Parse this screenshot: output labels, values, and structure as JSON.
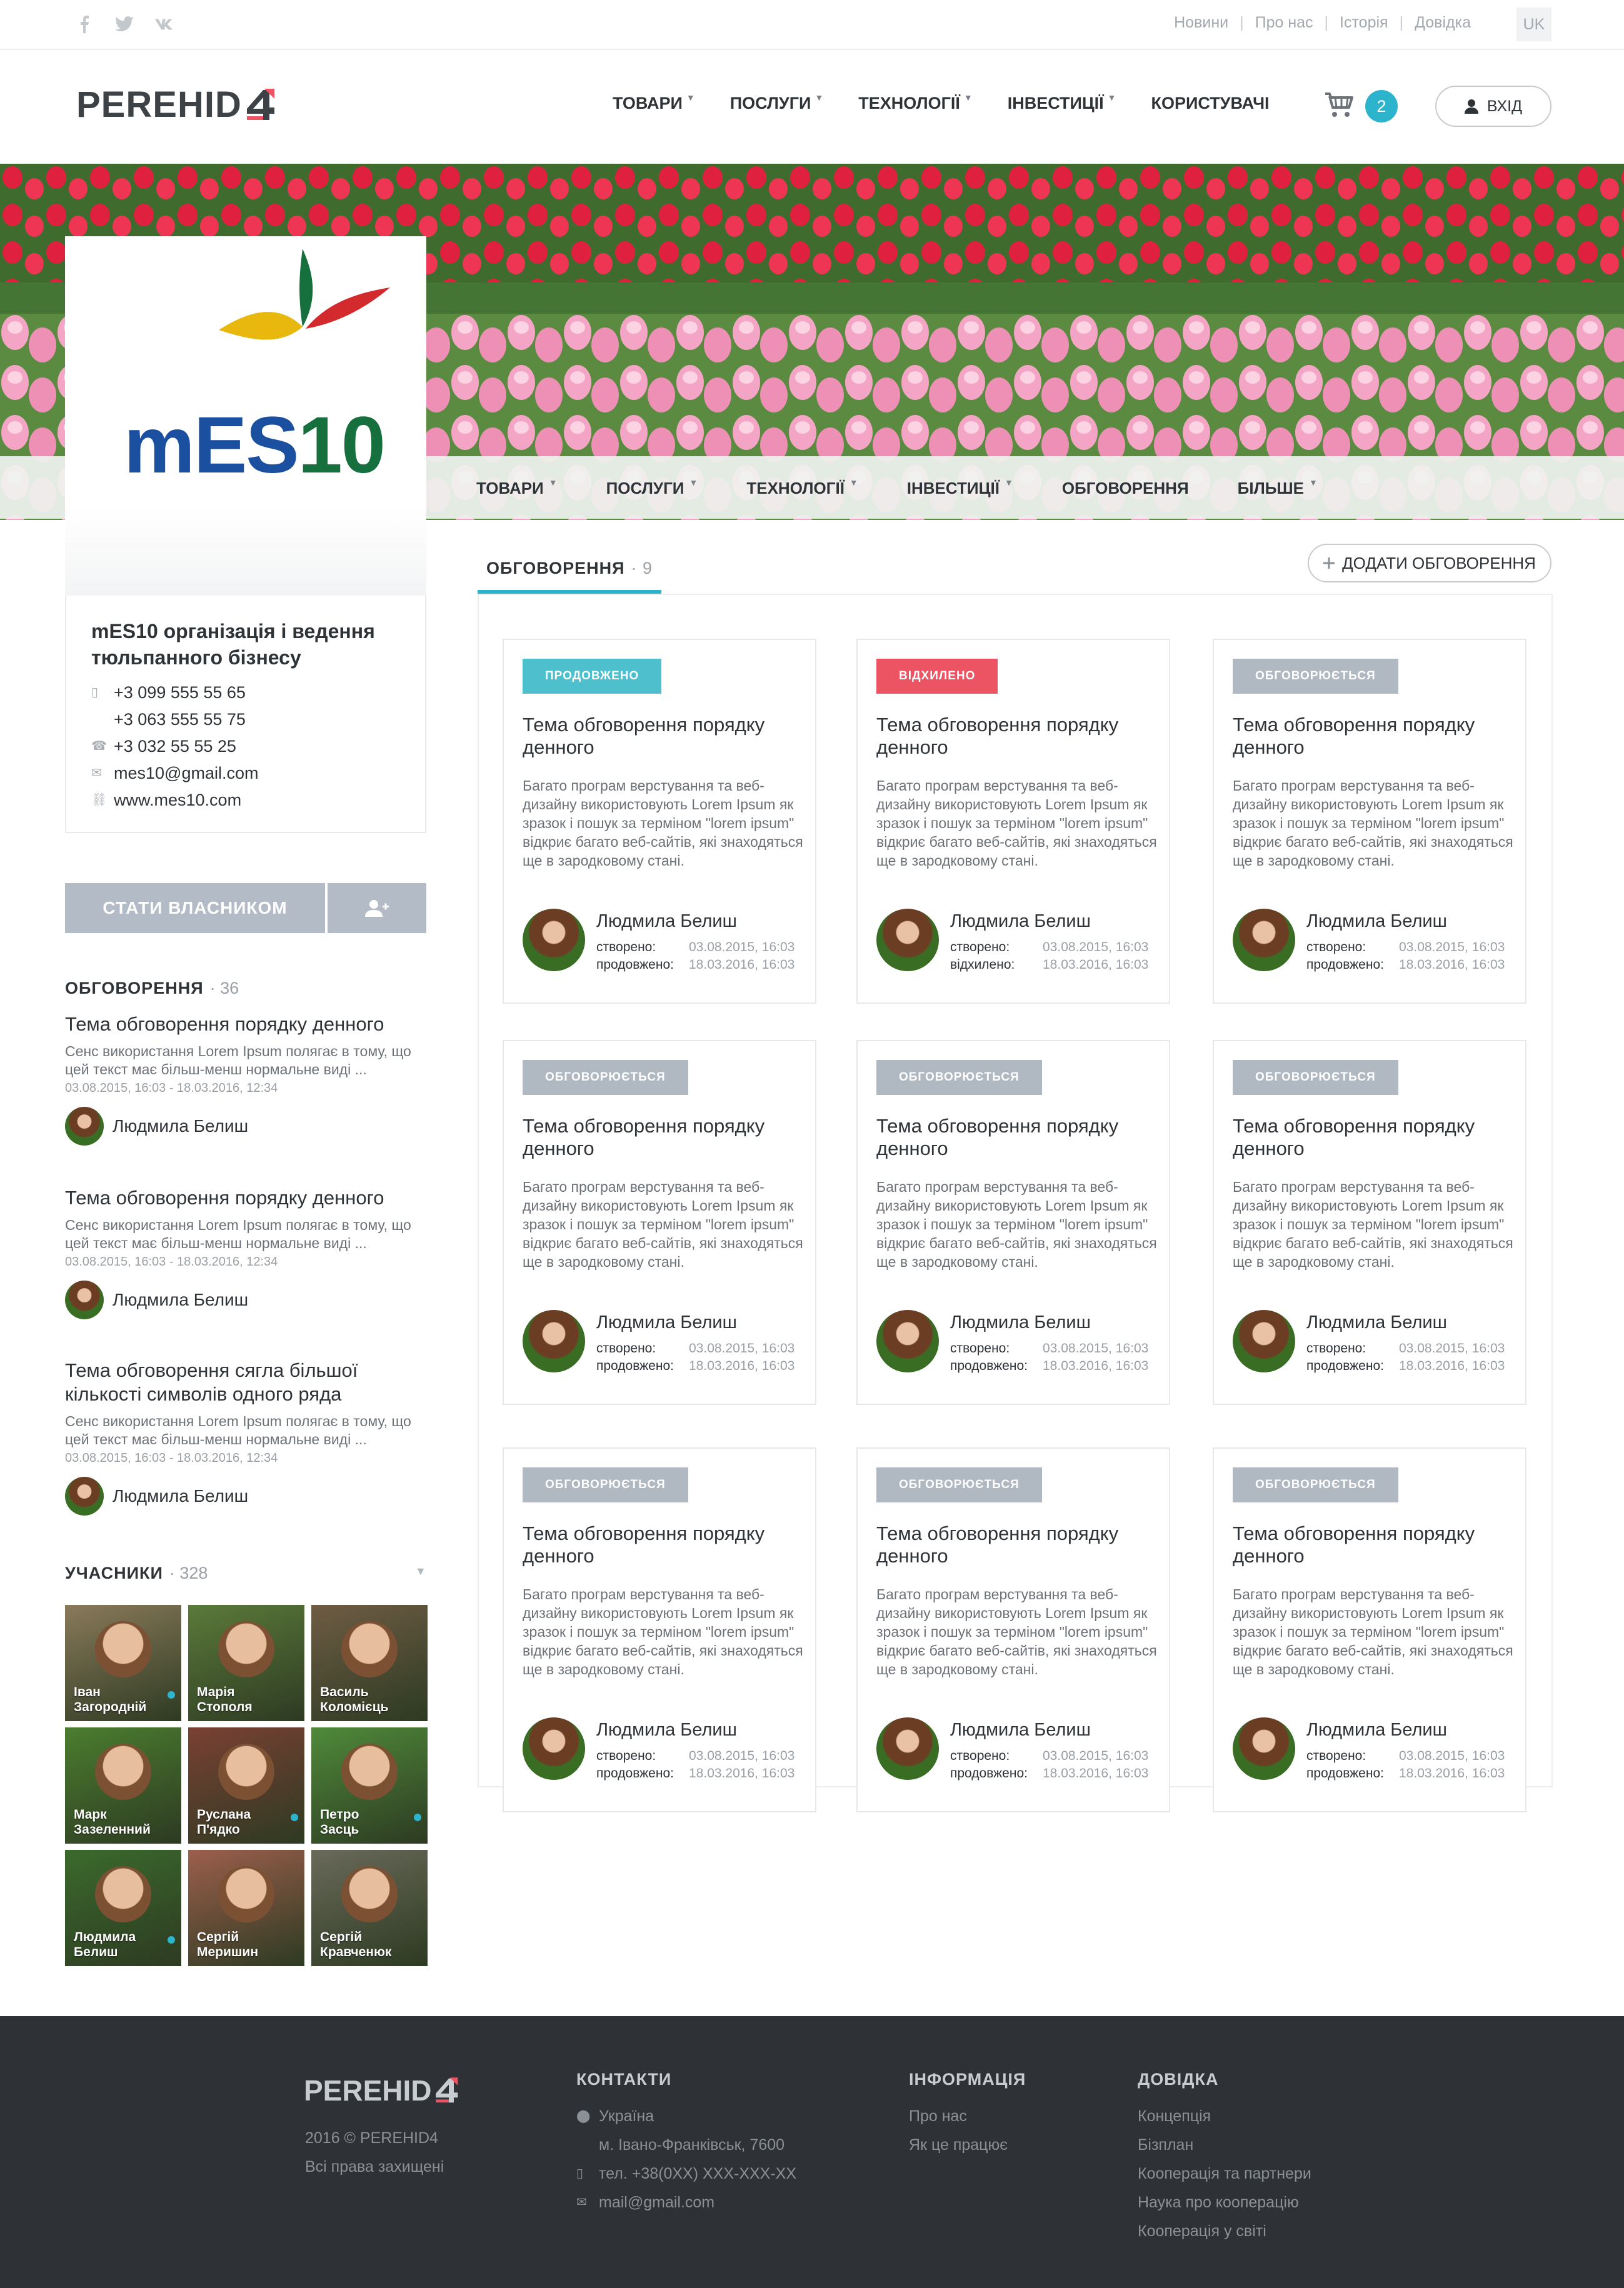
{
  "topbar": {
    "social": [
      {
        "icon": "facebook-icon",
        "glyph": "f"
      },
      {
        "icon": "twitter-icon",
        "glyph": "t"
      },
      {
        "icon": "vk-icon",
        "glyph": "vk"
      }
    ],
    "links": [
      "Новини",
      "Про нас",
      "Історія",
      "Довідка"
    ],
    "lang": "UK"
  },
  "header": {
    "logo_text": "PEREHID",
    "nav": [
      {
        "label": "ТОВАРИ",
        "caret": true
      },
      {
        "label": "ПОСЛУГИ",
        "caret": true
      },
      {
        "label": "ТЕХНОЛОГІЇ",
        "caret": true
      },
      {
        "label": "ІНВЕСТИЦІЇ",
        "caret": true
      },
      {
        "label": "КОРИСТУВАЧІ",
        "caret": false
      }
    ],
    "cart_count": "2",
    "login_label": "ВХІД"
  },
  "subnav": [
    {
      "label": "ТОВАРИ",
      "caret": true
    },
    {
      "label": "ПОСЛУГИ",
      "caret": true
    },
    {
      "label": "ТЕХНОЛОГІЇ",
      "caret": true
    },
    {
      "label": "ІНВЕСТИЦІЇ",
      "caret": true
    },
    {
      "label": "ОБГОВОРЕННЯ",
      "caret": false
    },
    {
      "label": "БІЛЬШЕ",
      "caret": true
    }
  ],
  "org": {
    "logo_text": "mES10",
    "name": "mES10 організація і ведення тюльпанного бізнесу",
    "contacts": [
      {
        "icon": "mobile-icon",
        "text": "+3 099  555 55 65"
      },
      {
        "icon": "",
        "text": "+3 063 555 55 75"
      },
      {
        "icon": "phone-icon",
        "text": "+3 032 55 55 25"
      },
      {
        "icon": "mail-icon",
        "text": "mes10@gmail.com"
      },
      {
        "icon": "link-icon",
        "text": "www.mes10.com"
      }
    ],
    "owner_button": "СТАТИ ВЛАСНИКОМ"
  },
  "side_discussions": {
    "title": "ОБГОВОРЕННЯ",
    "count": "· 36",
    "items": [
      {
        "title": "Тема обговорення порядку денного",
        "desc": "Сенс використання Lorem Ipsum полягає в тому, що цей текст має більш-менш нормальне виді ...",
        "dates": "03.08.2015, 16:03   -   18.03.2016, 12:34",
        "author": "Людмила Белиш"
      },
      {
        "title": "Тема обговорення порядку денного",
        "desc": "Сенс використання Lorem Ipsum полягає в тому, що цей текст має більш-менш нормальне виді ...",
        "dates": "03.08.2015, 16:03   -   18.03.2016, 12:34",
        "author": "Людмила Белиш"
      },
      {
        "title": "Тема обговорення сягла більшої кількості символів одного ряда",
        "desc": "Сенс використання Lorem Ipsum полягає в тому, що цей текст має більш-менш нормальне виді ...",
        "dates": "03.08.2015, 16:03   -   18.03.2016, 12:34",
        "author": "Людмила Белиш"
      }
    ]
  },
  "members": {
    "title": "УЧАСНИКИ",
    "count": "· 328",
    "items": [
      {
        "name": "Іван\nЗагородній",
        "online": true
      },
      {
        "name": "Марія\nСтополя",
        "online": false
      },
      {
        "name": "Василь\nКоломієць",
        "online": false
      },
      {
        "name": "Марк\nЗазеленний",
        "online": false
      },
      {
        "name": "Руслана\nП'ядко",
        "online": true
      },
      {
        "name": "Петро\nЗасць",
        "online": true
      },
      {
        "name": "Людмила\nБелиш",
        "online": true
      },
      {
        "name": "Сергій\nМеришин",
        "online": false
      },
      {
        "name": "Сергій\nКравченюк",
        "online": false
      }
    ]
  },
  "main": {
    "tab_label": "ОБГОВОРЕННЯ",
    "tab_count": "· 9",
    "add_button": "ДОДАТИ ОБГОВОРЕННЯ",
    "cards": [
      {
        "status": "ПРОДОВЖЕНО",
        "status_color": "#4dbfcd",
        "title": "Тема обговорення порядку денного",
        "desc": "Багато програм верстування та веб-дизайну використовують Lorem Ipsum як зразок і пошук за терміном \"lorem ipsum\" відкриє багато веб-сайтів, які знаходяться ще в зародковому стані.",
        "author": "Людмила Белиш",
        "k1": "створено:",
        "v1": "03.08.2015, 16:03",
        "k2": "продовжено:",
        "v2": "18.03.2016, 16:03"
      },
      {
        "status": "ВІДХИЛЕНО",
        "status_color": "#ec5464",
        "title": "Тема обговорення порядку денного",
        "desc": "Багато програм верстування та веб-дизайну використовують Lorem Ipsum як зразок і пошук за терміном \"lorem ipsum\" відкриє багато веб-сайтів, які знаходяться ще в зародковому стані.",
        "author": "Людмила Белиш",
        "k1": "створено:",
        "v1": "03.08.2015, 16:03",
        "k2": "відхилено:",
        "v2": "18.03.2016, 16:03"
      },
      {
        "status": "ОБГОВОРЮЄТЬСЯ",
        "status_color": "#b0b8c1",
        "title": "Тема обговорення порядку денного",
        "desc": "Багато програм верстування та веб-дизайну використовують Lorem Ipsum як зразок і пошук за терміном \"lorem ipsum\" відкриє багато веб-сайтів, які знаходяться ще в зародковому стані.",
        "author": "Людмила Белиш",
        "k1": "створено:",
        "v1": "03.08.2015, 16:03",
        "k2": "продовжено:",
        "v2": "18.03.2016, 16:03"
      },
      {
        "status": "ОБГОВОРЮЄТЬСЯ",
        "status_color": "#b0b8c1",
        "title": "Тема обговорення порядку денного",
        "desc": "Багато програм верстування та веб-дизайну використовують Lorem Ipsum як зразок і пошук за терміном \"lorem ipsum\" відкриє багато веб-сайтів, які знаходяться ще в зародковому стані.",
        "author": "Людмила Белиш",
        "k1": "створено:",
        "v1": "03.08.2015, 16:03",
        "k2": "продовжено:",
        "v2": "18.03.2016, 16:03"
      },
      {
        "status": "ОБГОВОРЮЄТЬСЯ",
        "status_color": "#b0b8c1",
        "title": "Тема обговорення порядку денного",
        "desc": "Багато програм верстування та веб-дизайну використовують Lorem Ipsum як зразок і пошук за терміном \"lorem ipsum\" відкриє багато веб-сайтів, які знаходяться ще в зародковому стані.",
        "author": "Людмила Белиш",
        "k1": "створено:",
        "v1": "03.08.2015, 16:03",
        "k2": "продовжено:",
        "v2": "18.03.2016, 16:03"
      },
      {
        "status": "ОБГОВОРЮЄТЬСЯ",
        "status_color": "#b0b8c1",
        "title": "Тема обговорення порядку денного",
        "desc": "Багато програм верстування та веб-дизайну використовують Lorem Ipsum як зразок і пошук за терміном \"lorem ipsum\" відкриє багато веб-сайтів, які знаходяться ще в зародковому стані.",
        "author": "Людмила Белиш",
        "k1": "створено:",
        "v1": "03.08.2015, 16:03",
        "k2": "продовжено:",
        "v2": "18.03.2016, 16:03"
      },
      {
        "status": "ОБГОВОРЮЄТЬСЯ",
        "status_color": "#b0b8c1",
        "title": "Тема обговорення порядку денного",
        "desc": "Багато програм верстування та веб-дизайну використовують Lorem Ipsum як зразок і пошук за терміном \"lorem ipsum\" відкриє багато веб-сайтів, які знаходяться ще в зародковому стані.",
        "author": "Людмила Белиш",
        "k1": "створено:",
        "v1": "03.08.2015, 16:03",
        "k2": "продовжено:",
        "v2": "18.03.2016, 16:03"
      },
      {
        "status": "ОБГОВОРЮЄТЬСЯ",
        "status_color": "#b0b8c1",
        "title": "Тема обговорення порядку денного",
        "desc": "Багато програм верстування та веб-дизайну використовують Lorem Ipsum як зразок і пошук за терміном \"lorem ipsum\" відкриє багато веб-сайтів, які знаходяться ще в зародковому стані.",
        "author": "Людмила Белиш",
        "k1": "створено:",
        "v1": "03.08.2015, 16:03",
        "k2": "продовжено:",
        "v2": "18.03.2016, 16:03"
      },
      {
        "status": "ОБГОВОРЮЄТЬСЯ",
        "status_color": "#b0b8c1",
        "title": "Тема обговорення порядку денного",
        "desc": "Багато програм верстування та веб-дизайну використовують Lorem Ipsum як зразок і пошук за терміном \"lorem ipsum\" відкриє багато веб-сайтів, які знаходяться ще в зародковому стані.",
        "author": "Людмила Белиш",
        "k1": "створено:",
        "v1": "03.08.2015, 16:03",
        "k2": "продовжено:",
        "v2": "18.03.2016, 16:03"
      }
    ]
  },
  "footer": {
    "logo_text": "PEREHID",
    "copyright": "2016 © PEREHID4",
    "rights": "Всі права захищені",
    "contacts_title": "КОНТАКТИ",
    "contacts": [
      {
        "icon": "pin-icon",
        "text": "Україна"
      },
      {
        "icon": "",
        "text": "м. Івано-Франківськ, 7600"
      },
      {
        "icon": "phone-icon",
        "text": "тел. +38(0XX) XXX-XXX-XX"
      },
      {
        "icon": "mail-icon",
        "text": "mail@gmail.com"
      }
    ],
    "info_title": "ІНФОРМАЦІЯ",
    "info": [
      "Про нас",
      "Як це працює"
    ],
    "help_title": "ДОВІДКА",
    "help": [
      "Концепція",
      "Бізплан",
      "Кооперація та партнери",
      "Наука про кооперацію",
      "Кооперація у світі"
    ]
  },
  "colors": {
    "accent": "#2bb4cc",
    "rejected": "#ec5464",
    "pending": "#b0b8c1",
    "footer_bg": "#2e3236"
  }
}
